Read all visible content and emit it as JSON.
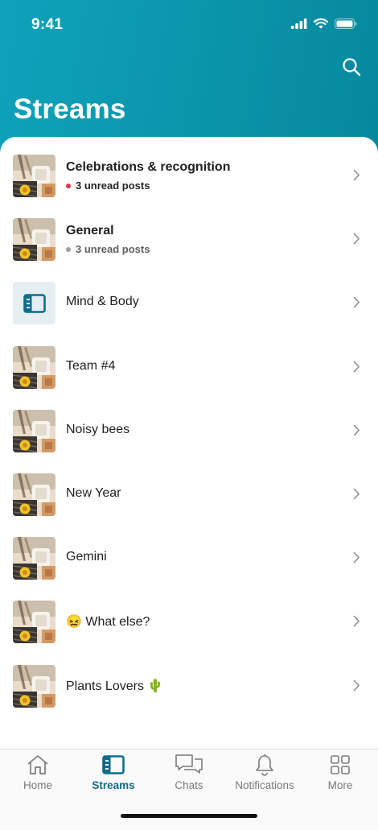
{
  "status_bar": {
    "time": "9:41"
  },
  "header": {
    "title": "Streams",
    "search_icon": "search-icon"
  },
  "streams": [
    {
      "title": "Celebrations & recognition",
      "unread": "3 unread posts",
      "dot_color": "#e8334a",
      "bold": true,
      "thumb": "photo"
    },
    {
      "title": "General",
      "unread": "3 unread posts",
      "dot_color": "#9e9e9e",
      "bold": true,
      "thumb": "photo"
    },
    {
      "title": "Mind & Body",
      "thumb": "streams-icon"
    },
    {
      "title": "Team #4",
      "thumb": "photo"
    },
    {
      "title": "Noisy bees",
      "thumb": "photo"
    },
    {
      "title": "New Year",
      "thumb": "photo"
    },
    {
      "title": "Gemini",
      "thumb": "photo"
    },
    {
      "title": "😖 What else?",
      "thumb": "photo"
    },
    {
      "title": "Plants Lovers 🌵",
      "thumb": "photo"
    }
  ],
  "tabs": [
    {
      "label": "Home",
      "icon": "home-icon",
      "active": false
    },
    {
      "label": "Streams",
      "icon": "streams-icon",
      "active": true
    },
    {
      "label": "Chats",
      "icon": "chats-icon",
      "active": false
    },
    {
      "label": "Notifications",
      "icon": "bell-icon",
      "active": false
    },
    {
      "label": "More",
      "icon": "grid-icon",
      "active": false
    }
  ],
  "colors": {
    "header": "#0b97ad",
    "accent": "#0e6c8b",
    "unread_dot": "#e8334a"
  }
}
